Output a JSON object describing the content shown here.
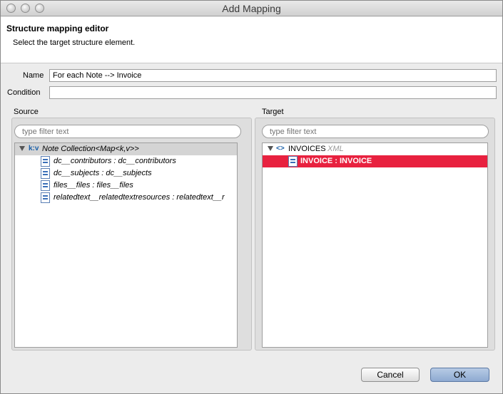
{
  "window": {
    "title": "Add Mapping"
  },
  "header": {
    "title": "Structure mapping editor",
    "description": "Select the target structure element."
  },
  "form": {
    "name_label": "Name",
    "name_value": "For each Note --> Invoice",
    "condition_label": "Condition",
    "condition_value": ""
  },
  "source": {
    "label": "Source",
    "filter_placeholder": "type filter text",
    "root": {
      "icon": "key-value-icon",
      "label": "Note Collection<Map<k,v>>"
    },
    "items": [
      {
        "label": "dc__contributors : dc__contributors"
      },
      {
        "label": "dc__subjects : dc__subjects"
      },
      {
        "label": "files__files : files__files"
      },
      {
        "label": "relatedtext__relatedtextresources : relatedtext__r"
      }
    ]
  },
  "target": {
    "label": "Target",
    "filter_placeholder": "type filter text",
    "root": {
      "icon": "xml-element-icon",
      "label": "INVOICES",
      "suffix": "XML"
    },
    "items": [
      {
        "label": "INVOICE : INVOICE",
        "selected": true
      }
    ]
  },
  "buttons": {
    "cancel": "Cancel",
    "ok": "OK"
  },
  "colors": {
    "selection": "#e8213f",
    "ok_button": "#9db6da"
  }
}
